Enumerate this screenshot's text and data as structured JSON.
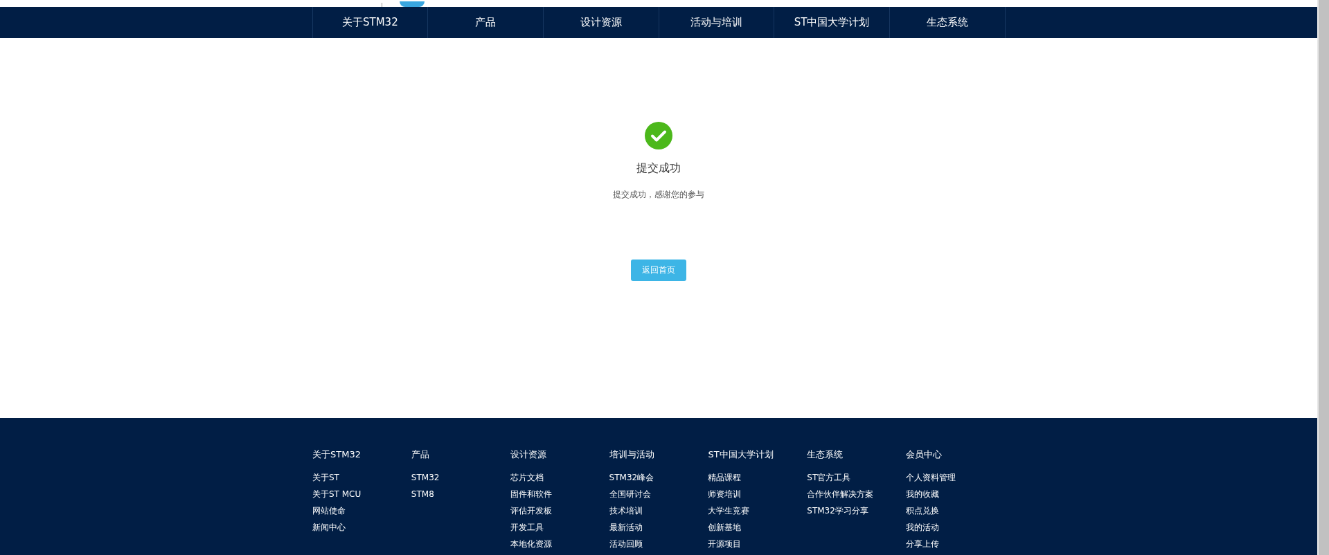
{
  "nav": {
    "items": [
      {
        "label": "关于STM32"
      },
      {
        "label": "产品"
      },
      {
        "label": "设计资源"
      },
      {
        "label": "活动与培训"
      },
      {
        "label": "ST中国大学计划"
      },
      {
        "label": "生态系统"
      }
    ]
  },
  "result": {
    "title": "提交成功",
    "message": "提交成功，感谢您的参与",
    "button": "返回首页"
  },
  "footer": {
    "columns": [
      {
        "heading": "关于STM32",
        "links": [
          "关于ST",
          "关于ST MCU",
          "网站使命",
          "新闻中心"
        ]
      },
      {
        "heading": "产品",
        "links": [
          "STM32",
          "STM8"
        ]
      },
      {
        "heading": "设计资源",
        "links": [
          "芯片文档",
          "固件和软件",
          "评估开发板",
          "开发工具",
          "本地化资源"
        ]
      },
      {
        "heading": "培训与活动",
        "links": [
          "STM32峰会",
          "全国研讨会",
          "技术培训",
          "最新活动",
          "活动回顾"
        ]
      },
      {
        "heading": "ST中国大学计划",
        "links": [
          "精品课程",
          "师资培训",
          "大学生竞赛",
          "创新基地",
          "开源项目"
        ]
      },
      {
        "heading": "生态系统",
        "links": [
          "ST官方工具",
          "合作伙伴解决方案",
          "STM32学习分享"
        ]
      },
      {
        "heading": "会员中心",
        "links": [
          "个人资料管理",
          "我的收藏",
          "积点兑换",
          "我的活动",
          "分享上传"
        ]
      }
    ]
  }
}
